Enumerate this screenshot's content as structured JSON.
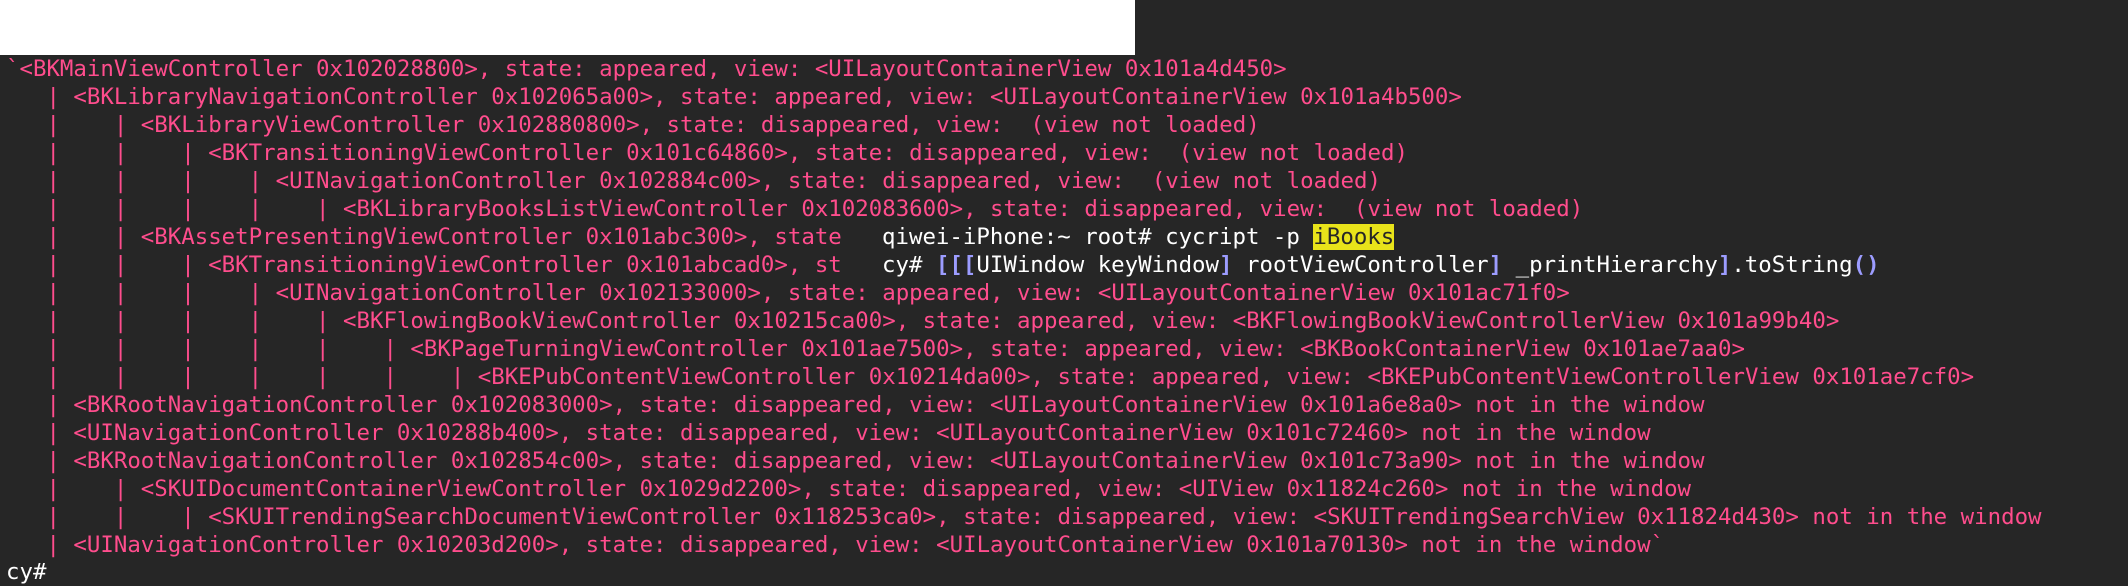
{
  "colors": {
    "background": "#262626",
    "output_text": "#ff4d8d",
    "prompt_text": "#ffffff",
    "highlight_bg": "#e8e31a",
    "bracket": "#9c9cff"
  },
  "hierarchy_lines": [
    "`<BKMainViewController 0x102028800>, state: appeared, view: <UILayoutContainerView 0x101a4d450>",
    "   | <BKLibraryNavigationController 0x102065a00>, state: appeared, view: <UILayoutContainerView 0x101a4b500>",
    "   |    | <BKLibraryViewController 0x102880800>, state: disappeared, view:  (view not loaded)",
    "   |    |    | <BKTransitioningViewController 0x101c64860>, state: disappeared, view:  (view not loaded)",
    "   |    |    |    | <UINavigationController 0x102884c00>, state: disappeared, view:  (view not loaded)",
    "   |    |    |    |    | <BKLibraryBooksListViewController 0x102083600>, state: disappeared, view:  (view not loaded)",
    "   |    | <BKAssetPresentingViewController 0x101abc300>, state",
    "   |    |    | <BKTransitioningViewController 0x101abcad0>, st",
    "   |    |    |    | <UINavigationController 0x102133000>, state: appeared, view: <UILayoutContainerView 0x101ac71f0>",
    "   |    |    |    |    | <BKFlowingBookViewController 0x10215ca00>, state: appeared, view: <BKFlowingBookViewControllerView 0x101a99b40>",
    "   |    |    |    |    |    | <BKPageTurningViewController 0x101ae7500>, state: appeared, view: <BKBookContainerView 0x101ae7aa0>",
    "   |    |    |    |    |    |    | <BKEPubContentViewController 0x10214da00>, state: appeared, view: <BKEPubContentViewControllerView 0x101ae7cf0>",
    "   | <BKRootNavigationController 0x102083000>, state: disappeared, view: <UILayoutContainerView 0x101a6e8a0> not in the window",
    "   | <UINavigationController 0x10288b400>, state: disappeared, view: <UILayoutContainerView 0x101c72460> not in the window",
    "   | <BKRootNavigationController 0x102854c00>, state: disappeared, view: <UILayoutContainerView 0x101c73a90> not in the window",
    "   |    | <SKUIDocumentContainerViewController 0x1029d2200>, state: disappeared, view: <UIView 0x11824c260> not in the window",
    "   |    |    | <SKUITrendingSearchDocumentViewController 0x118253ca0>, state: disappeared, view: <SKUITrendingSearchView 0x11824d430> not in the window",
    "   | <UINavigationController 0x10203d200>, state: disappeared, view: <UILayoutContainerView 0x101a70130> not in the window`"
  ],
  "prompt": {
    "host_text": "qiwei-iPhone:~ root# cycript -p ",
    "process": "iBooks",
    "cy_prefix": "cy# ",
    "br_open3": "[[[",
    "call_a": "UIWindow keyWindow",
    "br_close_a": "]",
    "call_b": " rootViewController",
    "br_close_b": "]",
    "call_c": " _printHierarchy",
    "br_close_c": "]",
    "call_d": ".toString",
    "parens": "()"
  },
  "last_prompt": "cy#"
}
